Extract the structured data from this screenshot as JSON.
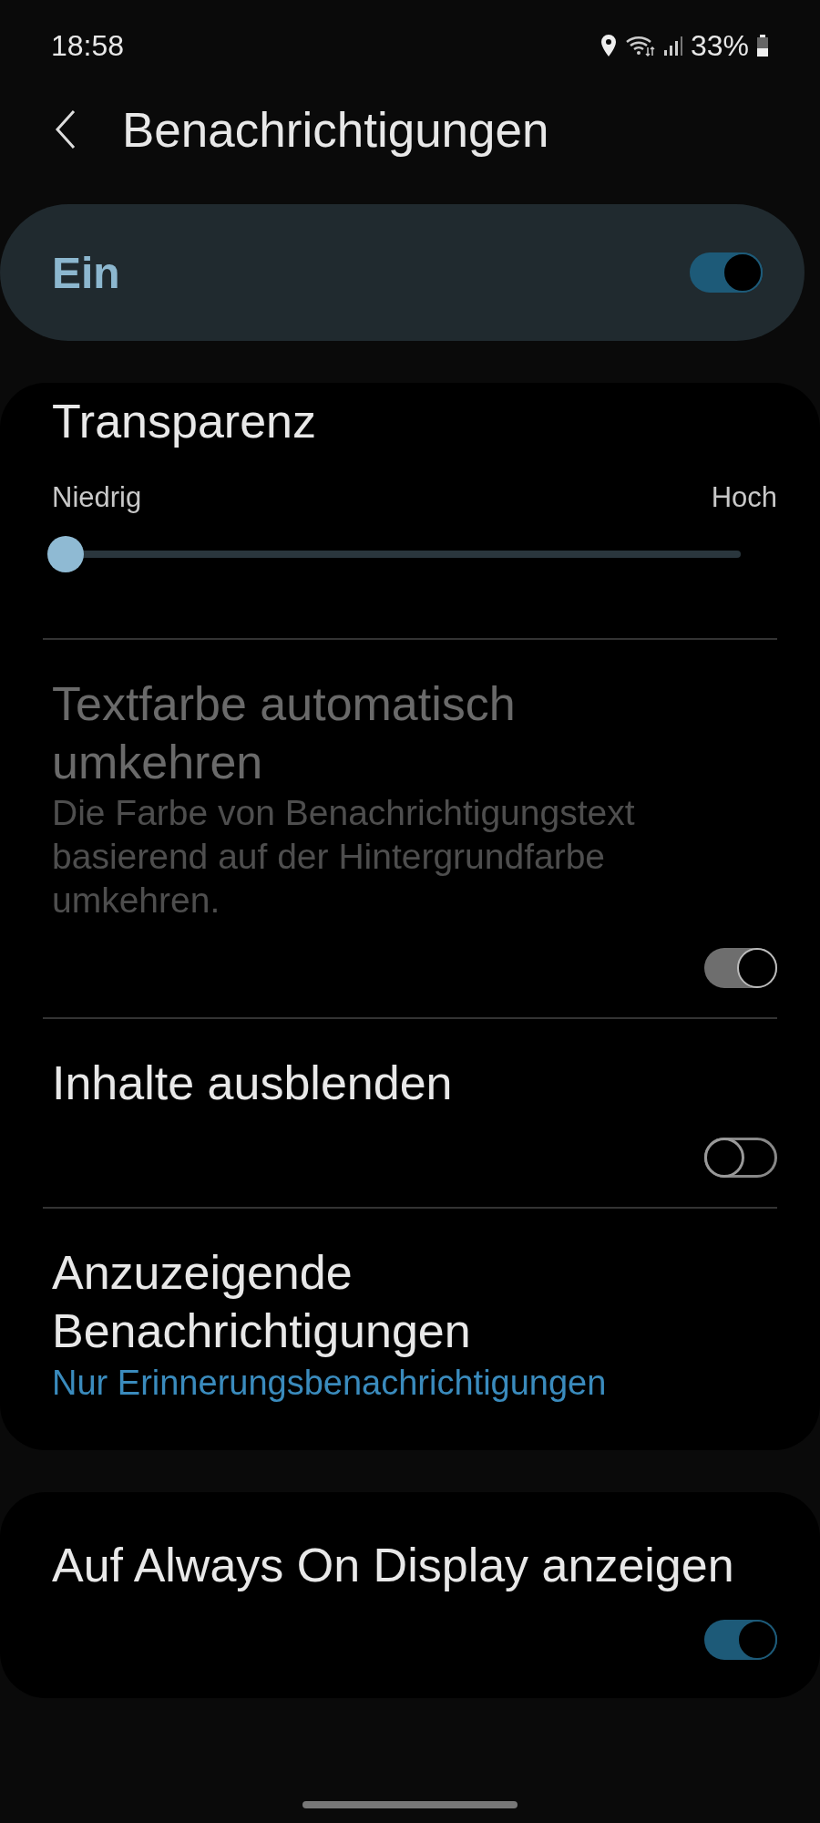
{
  "status_bar": {
    "time": "18:58",
    "battery": "33%"
  },
  "header": {
    "title": "Benachrichtigungen"
  },
  "master_switch": {
    "label": "Ein",
    "on": true
  },
  "transparency": {
    "title": "Transparenz",
    "min_label": "Niedrig",
    "max_label": "Hoch",
    "level": 0
  },
  "settings": [
    {
      "kind": "toggle",
      "title": "Textfarbe automatisch umkehren",
      "description": "Die Farbe von Benachrichtigungstext basierend auf der Hintergrundfarbe umkehren.",
      "on": true,
      "disabled": true
    },
    {
      "kind": "toggle",
      "title": "Inhalte ausblenden",
      "on": false,
      "disabled": false
    },
    {
      "kind": "link",
      "title": "Anzuzeigende Benachrichtigungen",
      "value": "Nur Erinnerungsbenachrichtigungen"
    }
  ],
  "always_on_display": {
    "title": "Auf Always On Display anzeigen",
    "on": true
  }
}
